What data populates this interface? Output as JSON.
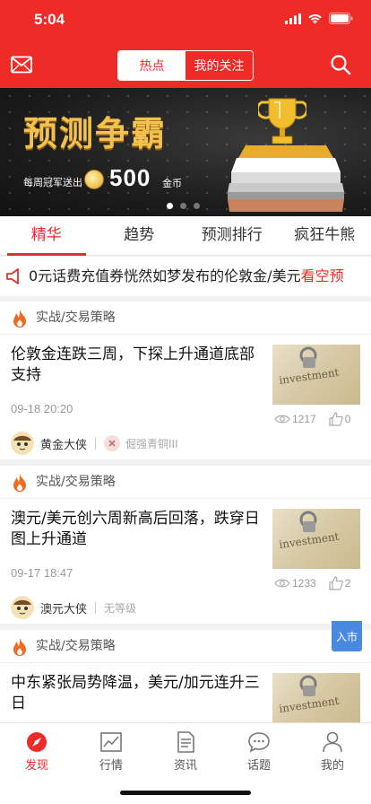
{
  "status": {
    "time": "5:04"
  },
  "header": {
    "segments": [
      "热点",
      "我的关注"
    ]
  },
  "banner": {
    "title": "预测争霸",
    "subtitle": "每周冠军送出",
    "amount": "500",
    "unit": "金币"
  },
  "tabs": [
    "精华",
    "趋势",
    "预测排行",
    "疯狂牛熊"
  ],
  "ticker": {
    "text": "0元话费充值券恍然如梦发布的伦敦金/美元",
    "highlight": "看空预"
  },
  "articles": [
    {
      "category": "实战/交易策略",
      "title": "伦敦金连跌三周，下探上升通道底部支持",
      "date": "09-18 20:20",
      "views": "1217",
      "likes": "0",
      "author": "黄金大侠",
      "level": "倔强青铜III"
    },
    {
      "category": "实战/交易策略",
      "title": "澳元/美元创六周新高后回落，跌穿日图上升通道",
      "date": "09-17 18:47",
      "views": "1233",
      "likes": "2",
      "author": "澳元大侠",
      "level": "无等级"
    },
    {
      "category": "实战/交易策略",
      "title": "中东紧张局势降温，美元/加元连升三日",
      "badge": "入市"
    }
  ],
  "tabbar": [
    "发现",
    "行情",
    "资讯",
    "话题",
    "我的"
  ],
  "colors": {
    "brand": "#ee2b26",
    "badge": "#4a89e0"
  },
  "thumb_text": "investment"
}
